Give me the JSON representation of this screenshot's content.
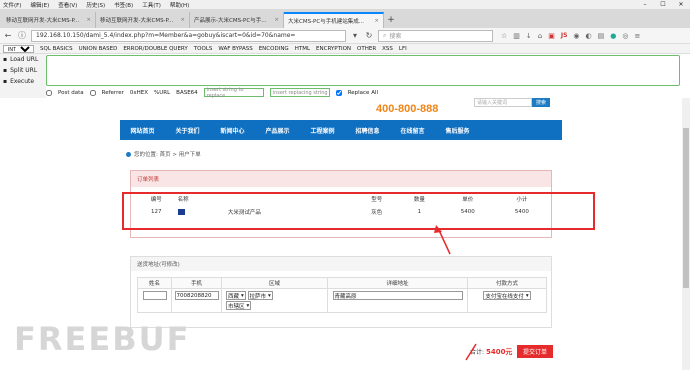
{
  "menu": [
    "文件(F)",
    "编辑(E)",
    "查看(V)",
    "历史(S)",
    "书签(B)",
    "工具(T)",
    "帮助(H)"
  ],
  "tabs": [
    {
      "label": "移动互联网开发-大米CMS-P..."
    },
    {
      "label": "移动互联网开发-大米CMS-P..."
    },
    {
      "label": "产品展示-大米CMS-PC与手..."
    },
    {
      "label": "大米CMS-PC与手机建站集成..."
    }
  ],
  "url": "192.168.10.150/dami_5.4/index.php?m=Member&a=gobuy&iscart=0&id=70&name=",
  "search_placeholder": "搜索",
  "hackbar": {
    "items": [
      "INT",
      "SQL BASICS",
      "UNION BASED",
      "ERROR/DOUBLE QUERY",
      "TOOLS",
      "WAF BYPASS",
      "ENCODING",
      "HTML",
      "ENCRYPTION",
      "OTHER",
      "XSS",
      "LFI"
    ],
    "load_url": "Load URL",
    "split_url": "Split URL",
    "execute": "Execute",
    "post_data": "Post data",
    "referrer": "Referrer",
    "hex": "0xHEX",
    "url_enc": "%URL",
    "base64": "BASE64",
    "find_placeholder": "insert string to replace",
    "replace_placeholder": "insert replacing string",
    "replace_all": "Replace All"
  },
  "site": {
    "phone": "400-800-888",
    "search_placeholder": "请输入关键词",
    "search_btn": "搜索",
    "nav": [
      "网站首页",
      "关于我们",
      "新闻中心",
      "产品展示",
      "工程案例",
      "招聘信息",
      "在线留言",
      "售后服务"
    ],
    "crumb": "您的位置: 首页 > 用户下单"
  },
  "order": {
    "title": "订单列表",
    "headers": [
      "编号",
      "名称",
      "",
      "型号",
      "数量",
      "单价",
      "小计"
    ],
    "row": {
      "id": "127",
      "name": "大米测试产品",
      "model": "灰色",
      "qty": "1",
      "price": "5400",
      "subtotal": "5400"
    }
  },
  "address": {
    "title": "送货地址(可修改)",
    "headers": [
      "姓名",
      "手机",
      "区域",
      "详细地址",
      "付款方式"
    ],
    "phone": "7008208820",
    "region1": "西藏",
    "region2": "拉萨市",
    "region3": "市辖区",
    "detail": "青藏高原",
    "payment": "支付宝在线支付"
  },
  "total_label": "合计:",
  "total_value": "5400元",
  "submit": "提交订单",
  "watermark": "FREEBUF",
  "colors": {
    "nav_blue": "#0f6fc0",
    "accent_orange": "#f08519",
    "highlight_red": "#e52b2b"
  }
}
